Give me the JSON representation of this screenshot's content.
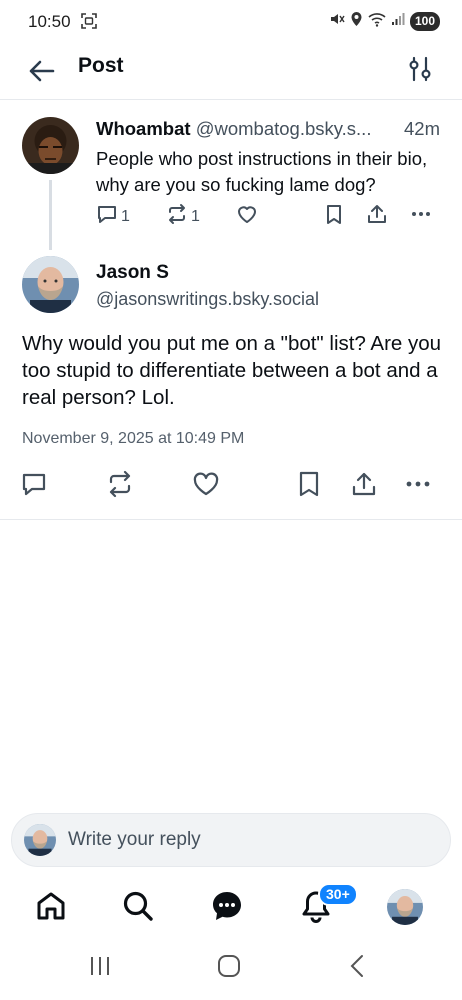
{
  "status_bar": {
    "time": "10:50",
    "battery": "100"
  },
  "header": {
    "title": "Post"
  },
  "parent_post": {
    "author_name": "Whoambat",
    "author_handle": "@wombatog.bsky.s...",
    "time_ago": "42m",
    "text": "People who post instructions in their bio, why are you so fucking lame dog?",
    "reply_count": "1",
    "repost_count": "1"
  },
  "main_post": {
    "author_name": "Jason S",
    "author_handle": "@jasonswritings.bsky.social",
    "text": "Why would you put me on a \"bot\" list? Are you too stupid to differentiate between a bot and a real person? Lol.",
    "date": "November 9, 2025 at 10:49 PM"
  },
  "reply_box": {
    "placeholder": "Write your reply"
  },
  "bottom_nav": {
    "notification_badge": "30+"
  },
  "colors": {
    "accent": "#1083fe",
    "text_primary": "#0b0f14",
    "text_secondary": "#44505c",
    "divider": "#e6e9ed",
    "icon": "#44505c"
  },
  "icons": [
    "back-arrow-icon",
    "sliders-icon",
    "reply-icon",
    "repost-icon",
    "like-icon",
    "bookmark-icon",
    "share-icon",
    "more-icon",
    "home-icon",
    "search-icon",
    "chat-icon",
    "bell-icon"
  ]
}
